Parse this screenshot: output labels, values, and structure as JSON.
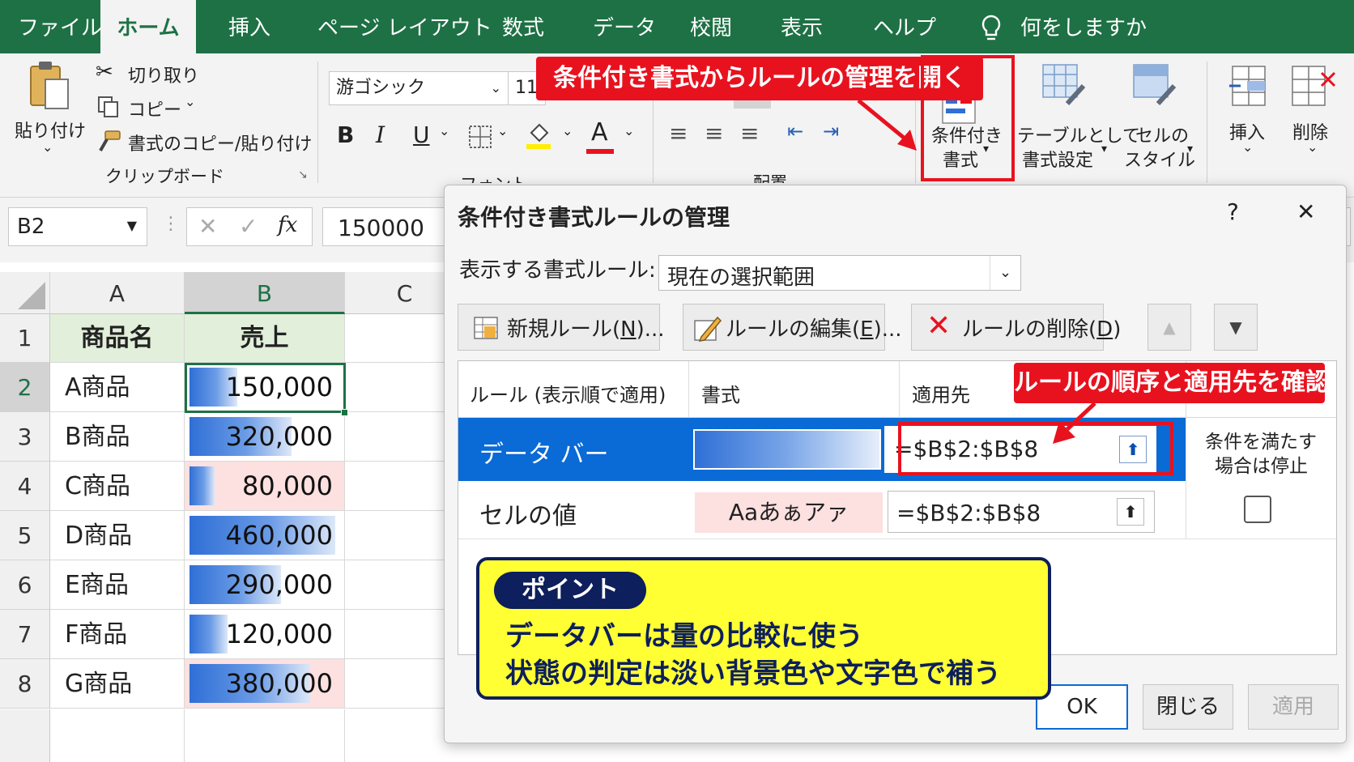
{
  "tabs": [
    "ファイル",
    "ホーム",
    "挿入",
    "ページ レイアウト",
    "数式",
    "データ",
    "校閲",
    "表示",
    "ヘルプ"
  ],
  "tell_me": "何をしますか",
  "ribbon": {
    "paste_label": "貼り付け",
    "cut_label": "切り取り",
    "copy_label": "コピー",
    "format_painter_label": "書式のコピー/貼り付け",
    "clipboard_group": "クリップボード",
    "font_name": "游ゴシック",
    "font_size": "11",
    "bold": "B",
    "italic": "I",
    "underline": "U",
    "font_color_glyph": "A",
    "font_group_partial": "フォント",
    "align_group_partial": "配置",
    "cond_format_line1": "条件付き",
    "cond_format_line2": "書式",
    "table_format_line1": "テーブルとして",
    "table_format_line2": "書式設定",
    "cell_style_line1": "セルの",
    "cell_style_line2": "スタイル",
    "insert_label": "挿入",
    "delete_label": "削除"
  },
  "formula_bar": {
    "name_box": "B2",
    "fx": "fx",
    "value": "150000"
  },
  "sheet": {
    "columns": [
      "A",
      "B",
      "C"
    ],
    "header_row": {
      "row": "1",
      "col_a": "商品名",
      "col_b": "売上"
    },
    "rows": [
      {
        "row": "2",
        "name": "A商品",
        "value": "150,000",
        "bar": 0.33,
        "highlight": false
      },
      {
        "row": "3",
        "name": "B商品",
        "value": "320,000",
        "bar": 0.7,
        "highlight": false
      },
      {
        "row": "4",
        "name": "C商品",
        "value": "80,000",
        "bar": 0.17,
        "highlight": true
      },
      {
        "row": "5",
        "name": "D商品",
        "value": "460,000",
        "bar": 1.0,
        "highlight": false
      },
      {
        "row": "6",
        "name": "E商品",
        "value": "290,000",
        "bar": 0.63,
        "highlight": false
      },
      {
        "row": "7",
        "name": "F商品",
        "value": "120,000",
        "bar": 0.26,
        "highlight": false
      },
      {
        "row": "8",
        "name": "G商品",
        "value": "380,000",
        "bar": 0.83,
        "highlight": true
      }
    ]
  },
  "dialog": {
    "title": "条件付き書式ルールの管理",
    "help": "?",
    "close": "✕",
    "show_rules_label": "表示する書式ルール:",
    "show_rules_value": "現在の選択範囲",
    "new_rule": {
      "text": "新規ルール(",
      "key": "N",
      "tail": ")..."
    },
    "edit_rule": {
      "text": "ルールの編集(",
      "key": "E",
      "tail": ")..."
    },
    "delete_rule": {
      "text": "ルールの削除(",
      "key": "D",
      "tail": ")"
    },
    "col_rule": "ルール (表示順で適用)",
    "col_format": "書式",
    "col_applies": "適用先",
    "col_stop_line1": "条件を満たす",
    "col_stop_line2": "場合は停止",
    "rules": [
      {
        "name": "データ バー",
        "preview": "",
        "applies": "=$B$2:$B$8",
        "selected": true
      },
      {
        "name": "セルの値",
        "preview": "Aaあぁアァ",
        "applies": "=$B$2:$B$8",
        "selected": false
      }
    ],
    "ok": "OK",
    "close_button": "閉じる",
    "apply": "適用"
  },
  "callouts": {
    "top": "条件付き書式からルールの管理を開く",
    "right": "ルールの順序と適用先を確認"
  },
  "point": {
    "badge": "ポイント",
    "line1": "データバーは量の比較に使う",
    "line2": "状態の判定は淡い背景色や文字色で補う"
  },
  "colors": {
    "excel_green": "#1e7145",
    "selection_blue": "#0a6ad6",
    "callout_red": "#e8121f",
    "point_yellow": "#ffff33",
    "point_navy": "#0d1f5c",
    "highlight_pink": "#fde0e0",
    "header_green": "#e2efda"
  }
}
